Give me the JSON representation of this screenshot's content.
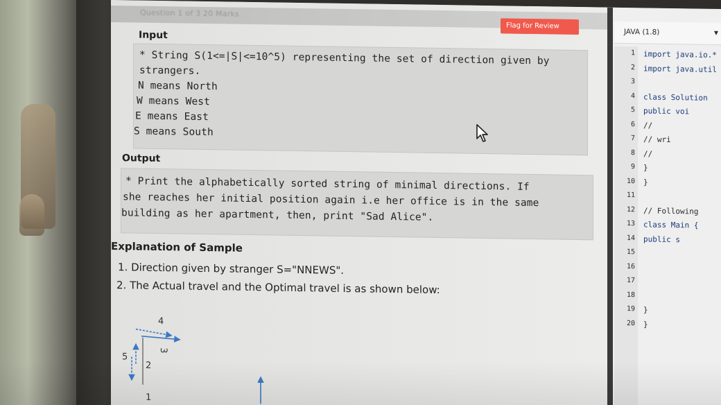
{
  "header": {
    "question_meta": "Question 1 of 3   20 Marks",
    "flag_button": "Flag for Review",
    "language": "JAVA (1.8)"
  },
  "problem": {
    "input_title": "Input",
    "input_lines": [
      "* String S(1<=|S|<=10^5) representing the set of direction given by",
      "strangers.",
      "N means North",
      "W means West",
      "E means East",
      "S means South"
    ],
    "output_title": "Output",
    "output_lines": [
      "* Print the alphabetically sorted string of minimal directions. If",
      "she reaches her initial position again i.e her office is in the same",
      "building as her apartment, then, print \"Sad Alice\"."
    ],
    "explanation_title": "Explanation of Sample",
    "explanation_lines": [
      "1. Direction given by stranger S=\"NNEWS\".",
      "2. The Actual travel and the Optimal travel is as shown below:"
    ],
    "diagram_labels": [
      "4",
      "3",
      "5",
      "2",
      "1"
    ]
  },
  "editor": {
    "lines": [
      {
        "num": "1",
        "code": "import java.io.*"
      },
      {
        "num": "2",
        "code": "import java.util"
      },
      {
        "num": "3",
        "code": ""
      },
      {
        "num": "4",
        "code": "class Solution"
      },
      {
        "num": "5",
        "code": "    public voi"
      },
      {
        "num": "6",
        "code": "        //"
      },
      {
        "num": "7",
        "code": "        // wri"
      },
      {
        "num": "8",
        "code": "        //"
      },
      {
        "num": "9",
        "code": "    }"
      },
      {
        "num": "10",
        "code": "}"
      },
      {
        "num": "11",
        "code": ""
      },
      {
        "num": "12",
        "code": "// Following"
      },
      {
        "num": "13",
        "code": "class Main {"
      },
      {
        "num": "14",
        "code": "    public s"
      },
      {
        "num": "15",
        "code": ""
      },
      {
        "num": "16",
        "code": ""
      },
      {
        "num": "17",
        "code": ""
      },
      {
        "num": "18",
        "code": ""
      },
      {
        "num": "19",
        "code": "            }"
      },
      {
        "num": "20",
        "code": "    }"
      }
    ]
  },
  "colors": {
    "flag_button": "#f05a4d",
    "code_keyword": "#1b3b7a",
    "diagram_arrow": "#3b78c4"
  }
}
